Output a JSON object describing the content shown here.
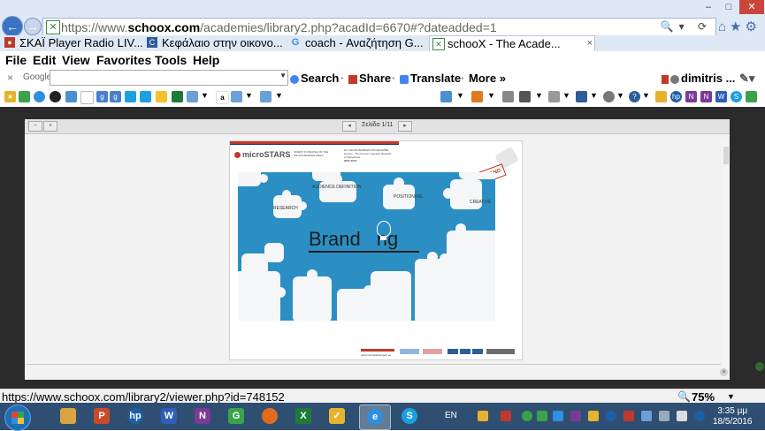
{
  "window": {
    "address_url_prefix": "https://www.",
    "address_host": "schoox.com",
    "address_path": "/academies/library2.php?acadId=6670#?dateadded=1",
    "window_controls": {
      "minimize": "–",
      "maximize": "□",
      "close": "✕"
    }
  },
  "tabs": [
    {
      "label": "ΣΚΑΪ Player Radio LIV...",
      "icon": "radio-icon",
      "icon_color": "#c0392b"
    },
    {
      "label": "Κεφάλαιο στην οικονο...",
      "icon": "c-icon",
      "icon_color": "#2e5c9a"
    },
    {
      "label": "coach - Αναζήτηση G...",
      "icon": "google-icon",
      "icon_color": "#4285f4"
    },
    {
      "label": "schooX - The Acade...",
      "icon": "schoox-icon",
      "icon_color": "#3c8a3c",
      "active": true,
      "close": "×"
    }
  ],
  "menu": [
    "File",
    "Edit",
    "View",
    "Favorites",
    "Tools",
    "Help"
  ],
  "google_toolbar": {
    "close": "×",
    "logo": "Google",
    "search_value": "",
    "search_label": "Search",
    "share_label": "Share",
    "translate_label": "Translate",
    "more_label": "More",
    "more_suffix": "»",
    "separator": "·",
    "user_label": "dimitris ..."
  },
  "viewer": {
    "page_label": "Σελίδα 1/11",
    "zoom_in": "+",
    "zoom_out": "−",
    "prev": "◂",
    "next": "▸",
    "close": "×"
  },
  "document": {
    "logo_text": "microSTARS",
    "header_invest": "INVEST IN PEOPLE OF THE CROSS-BORDER AREA",
    "header_program": "EU CROSS-BORDER PROGRAMME Greece - The Former Yugoslav Republic of Macedonia",
    "header_years": "2007-2013",
    "stamp": "BRAND",
    "labels": {
      "audience": "AUDIENCE DEFINITION",
      "research": "RESEARCH",
      "positioning": "POSITIONING",
      "creative": "CREATIVE"
    },
    "title_part1": "Brand",
    "title_part2": "ng",
    "footer_site": "www.microstarsproject.eu"
  },
  "status": {
    "url": "https://www.schoox.com/library2/viewer.php?id=748152",
    "zoom": "75%"
  },
  "taskbar": {
    "language": "EN",
    "time": "3:35 μμ",
    "date": "18/5/2016",
    "apps": [
      {
        "name": "explorer",
        "color": "#d9a441",
        "glyph": ""
      },
      {
        "name": "powerpoint",
        "color": "#c94a2a",
        "glyph": "P"
      },
      {
        "name": "hp",
        "color": "#1d5fa8",
        "glyph": "hp"
      },
      {
        "name": "word",
        "color": "#2b5fb8",
        "glyph": "W"
      },
      {
        "name": "onenote",
        "color": "#7b3a96",
        "glyph": "N"
      },
      {
        "name": "chrome",
        "color": "#3aa34a",
        "glyph": "G"
      },
      {
        "name": "firefox",
        "color": "#e06b1f",
        "glyph": ""
      },
      {
        "name": "excel",
        "color": "#1f7a3a",
        "glyph": "X"
      },
      {
        "name": "tasks",
        "color": "#e6b32e",
        "glyph": "✓"
      },
      {
        "name": "ie",
        "color": "#2e8fe0",
        "glyph": "e"
      },
      {
        "name": "skype",
        "color": "#1aa0e0",
        "glyph": "S"
      }
    ]
  }
}
